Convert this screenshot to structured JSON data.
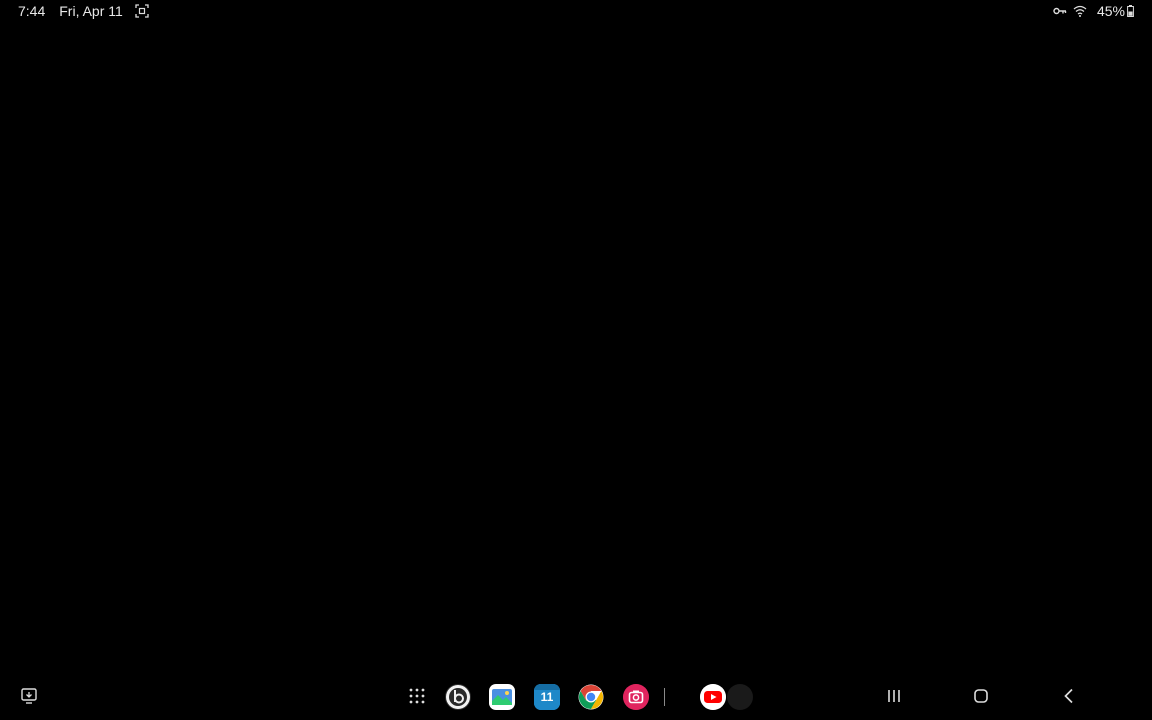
{
  "status_bar": {
    "time": "7:44",
    "date": "Fri, Apr 11",
    "battery_percent": "45%",
    "icons": [
      "screenshot-icon",
      "vpn-key-icon",
      "wifi-icon",
      "battery-icon"
    ]
  },
  "taskbar": {
    "left_icon": "screen-capture-icon",
    "apps": [
      {
        "name": "app-drawer",
        "icon": "grid-icon"
      },
      {
        "name": "beats",
        "icon": "beats-icon",
        "color": "#ffffff"
      },
      {
        "name": "gallery",
        "icon": "gallery-icon",
        "color": "#4a90e2"
      },
      {
        "name": "calendar",
        "icon": "calendar-icon",
        "color": "#1e88c8",
        "label": "11"
      },
      {
        "name": "chrome",
        "icon": "chrome-icon"
      },
      {
        "name": "screen-recorder",
        "icon": "camera-icon",
        "color": "#e0245e"
      },
      {
        "name": "youtube",
        "icon": "youtube-icon",
        "color": "#ff0000"
      },
      {
        "name": "recent-app",
        "icon": "dark-app-icon",
        "color": "#1a1a1a"
      }
    ],
    "nav": [
      "recents-icon",
      "home-icon",
      "back-icon"
    ]
  }
}
